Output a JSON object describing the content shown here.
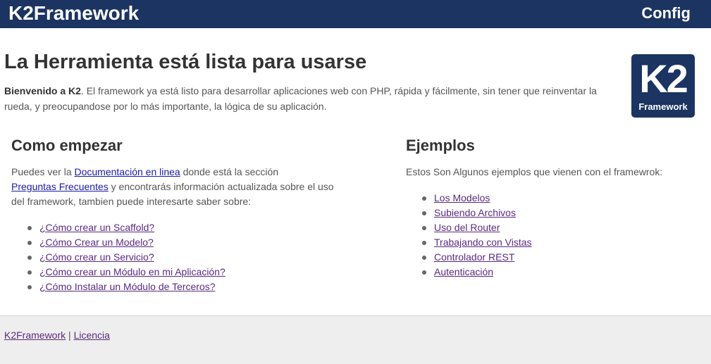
{
  "header": {
    "brand": "K2Framework",
    "config_label": "Config"
  },
  "hero": {
    "title": "La Herramienta está lista para usarse",
    "intro_bold": "Bienvenido a K2",
    "intro_text": ". El framework ya está listo para desarrollar aplicaciones web con PHP, rápida y fácilmente, sin tener que reinventar la rueda, y preocupandose por lo más importante, la lógica de su aplicación."
  },
  "logo": {
    "main": "K2",
    "sub": "Framework"
  },
  "start": {
    "title": "Como empezar",
    "text_1": "Puedes ver la ",
    "docs_link": "Documentación en linea",
    "text_2": " donde está la sección ",
    "faq_link": "Preguntas Frecuentes",
    "text_3": " y encontrarás información actualizada sobre el uso del framework, tambien puede interesarte saber sobre:",
    "items": [
      "¿Cómo crear un Scaffold?",
      "¿Cómo Crear un Modelo?",
      "¿Cómo crear un Servicio?",
      "¿Cómo crear un Módulo en mi Aplicación?",
      "¿Cómo Instalar un Módulo de Terceros?"
    ]
  },
  "examples": {
    "title": "Ejemplos",
    "intro": "Estos Son Algunos ejemplos que vienen con el framewrok:",
    "items": [
      "Los Modelos",
      "Subiendo Archivos",
      "Uso del Router",
      "Trabajando con Vistas",
      "Controlador REST",
      "Autenticación"
    ]
  },
  "footer": {
    "brand_link": "K2Framework",
    "separator": "|",
    "license_link": "Licencia"
  },
  "colors": {
    "topbar": "#1b3461",
    "link": "#1a1aa6",
    "visited_link": "#5a2a82",
    "footer_bg": "#eeeeee"
  }
}
